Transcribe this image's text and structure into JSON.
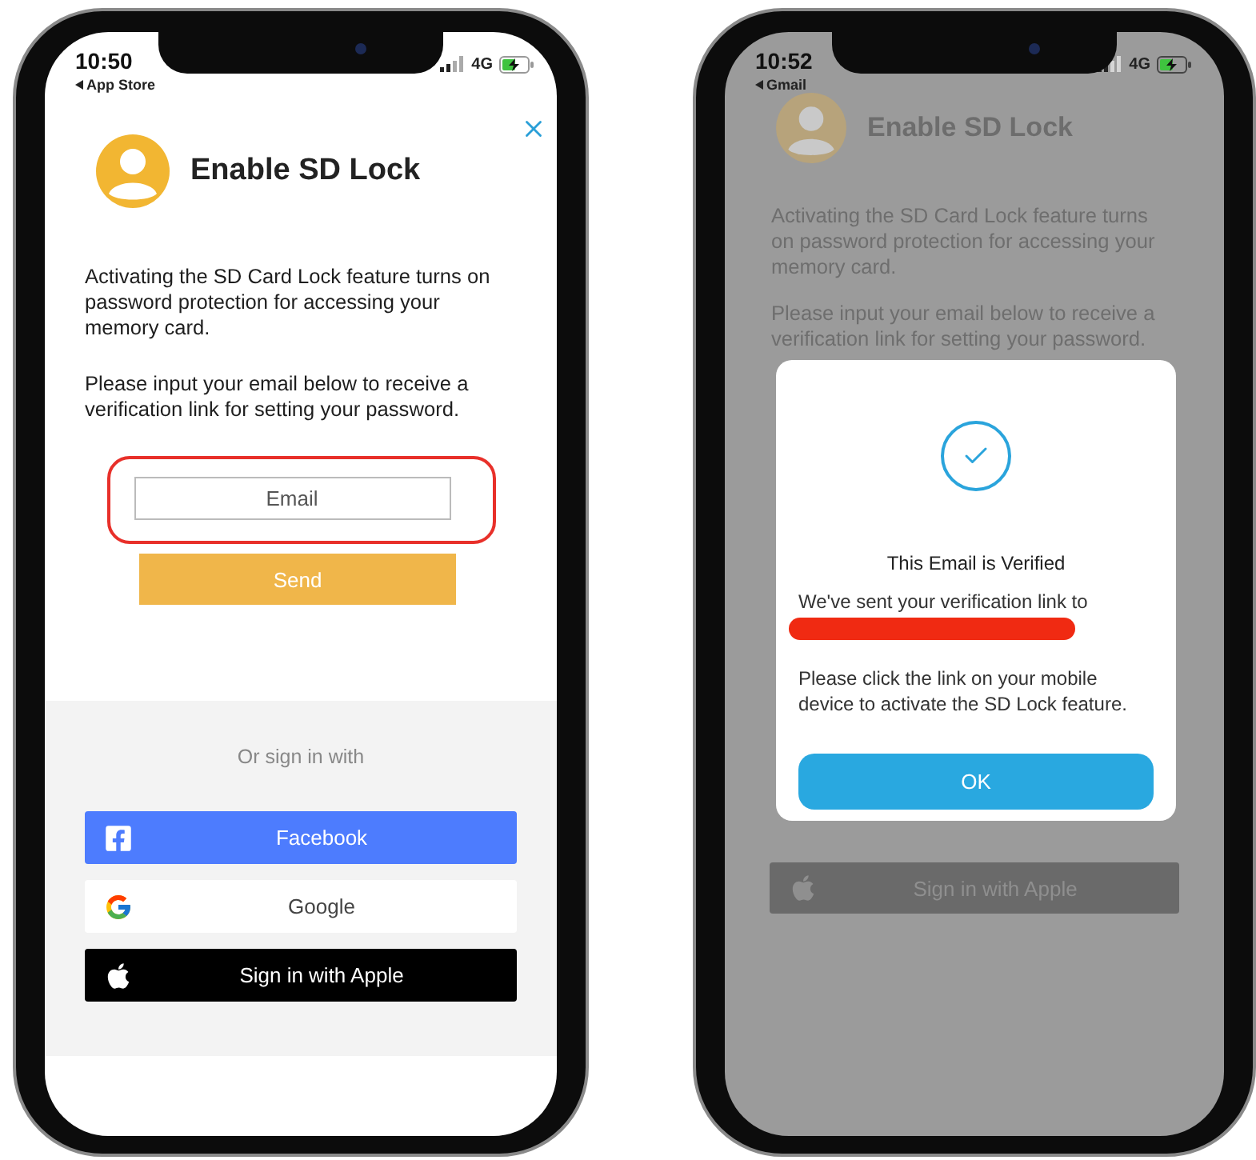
{
  "phones": [
    {
      "kind": "form",
      "status_bar": {
        "time": "10:50",
        "back_app": "App Store",
        "network": "4G"
      },
      "header": {
        "title": "Enable SD Lock"
      },
      "paragraphs": [
        "Activating the SD Card Lock feature turns on password protection for accessing your memory card.",
        "Please input your email below to receive a verification link for setting your password."
      ],
      "email_field": {
        "placeholder": "Email",
        "highlighted": true
      },
      "send_button": "Send",
      "alt_signin": {
        "label": "Or sign in with",
        "providers": [
          {
            "kind": "facebook",
            "label": "Facebook"
          },
          {
            "kind": "google",
            "label": "Google"
          },
          {
            "kind": "apple",
            "label": "Sign in with Apple"
          }
        ]
      }
    },
    {
      "kind": "dialog",
      "status_bar": {
        "time": "10:52",
        "back_app": "Gmail",
        "network": "4G"
      },
      "header": {
        "title": "Enable SD Lock"
      },
      "paragraphs": [
        "Activating the SD Card Lock feature turns on password protection for accessing your memory card.",
        "Please input your email below to receive a verification link for setting your password."
      ],
      "providers": [
        {
          "kind": "apple",
          "label": "Sign in with Apple"
        }
      ],
      "dialog": {
        "title": "This Email is Verified",
        "sent_text": "We've sent your verification link to",
        "recipient_redacted": true,
        "message": "Please click the link on your mobile device to activate the SD Lock feature.",
        "button": "OK"
      }
    }
  ]
}
